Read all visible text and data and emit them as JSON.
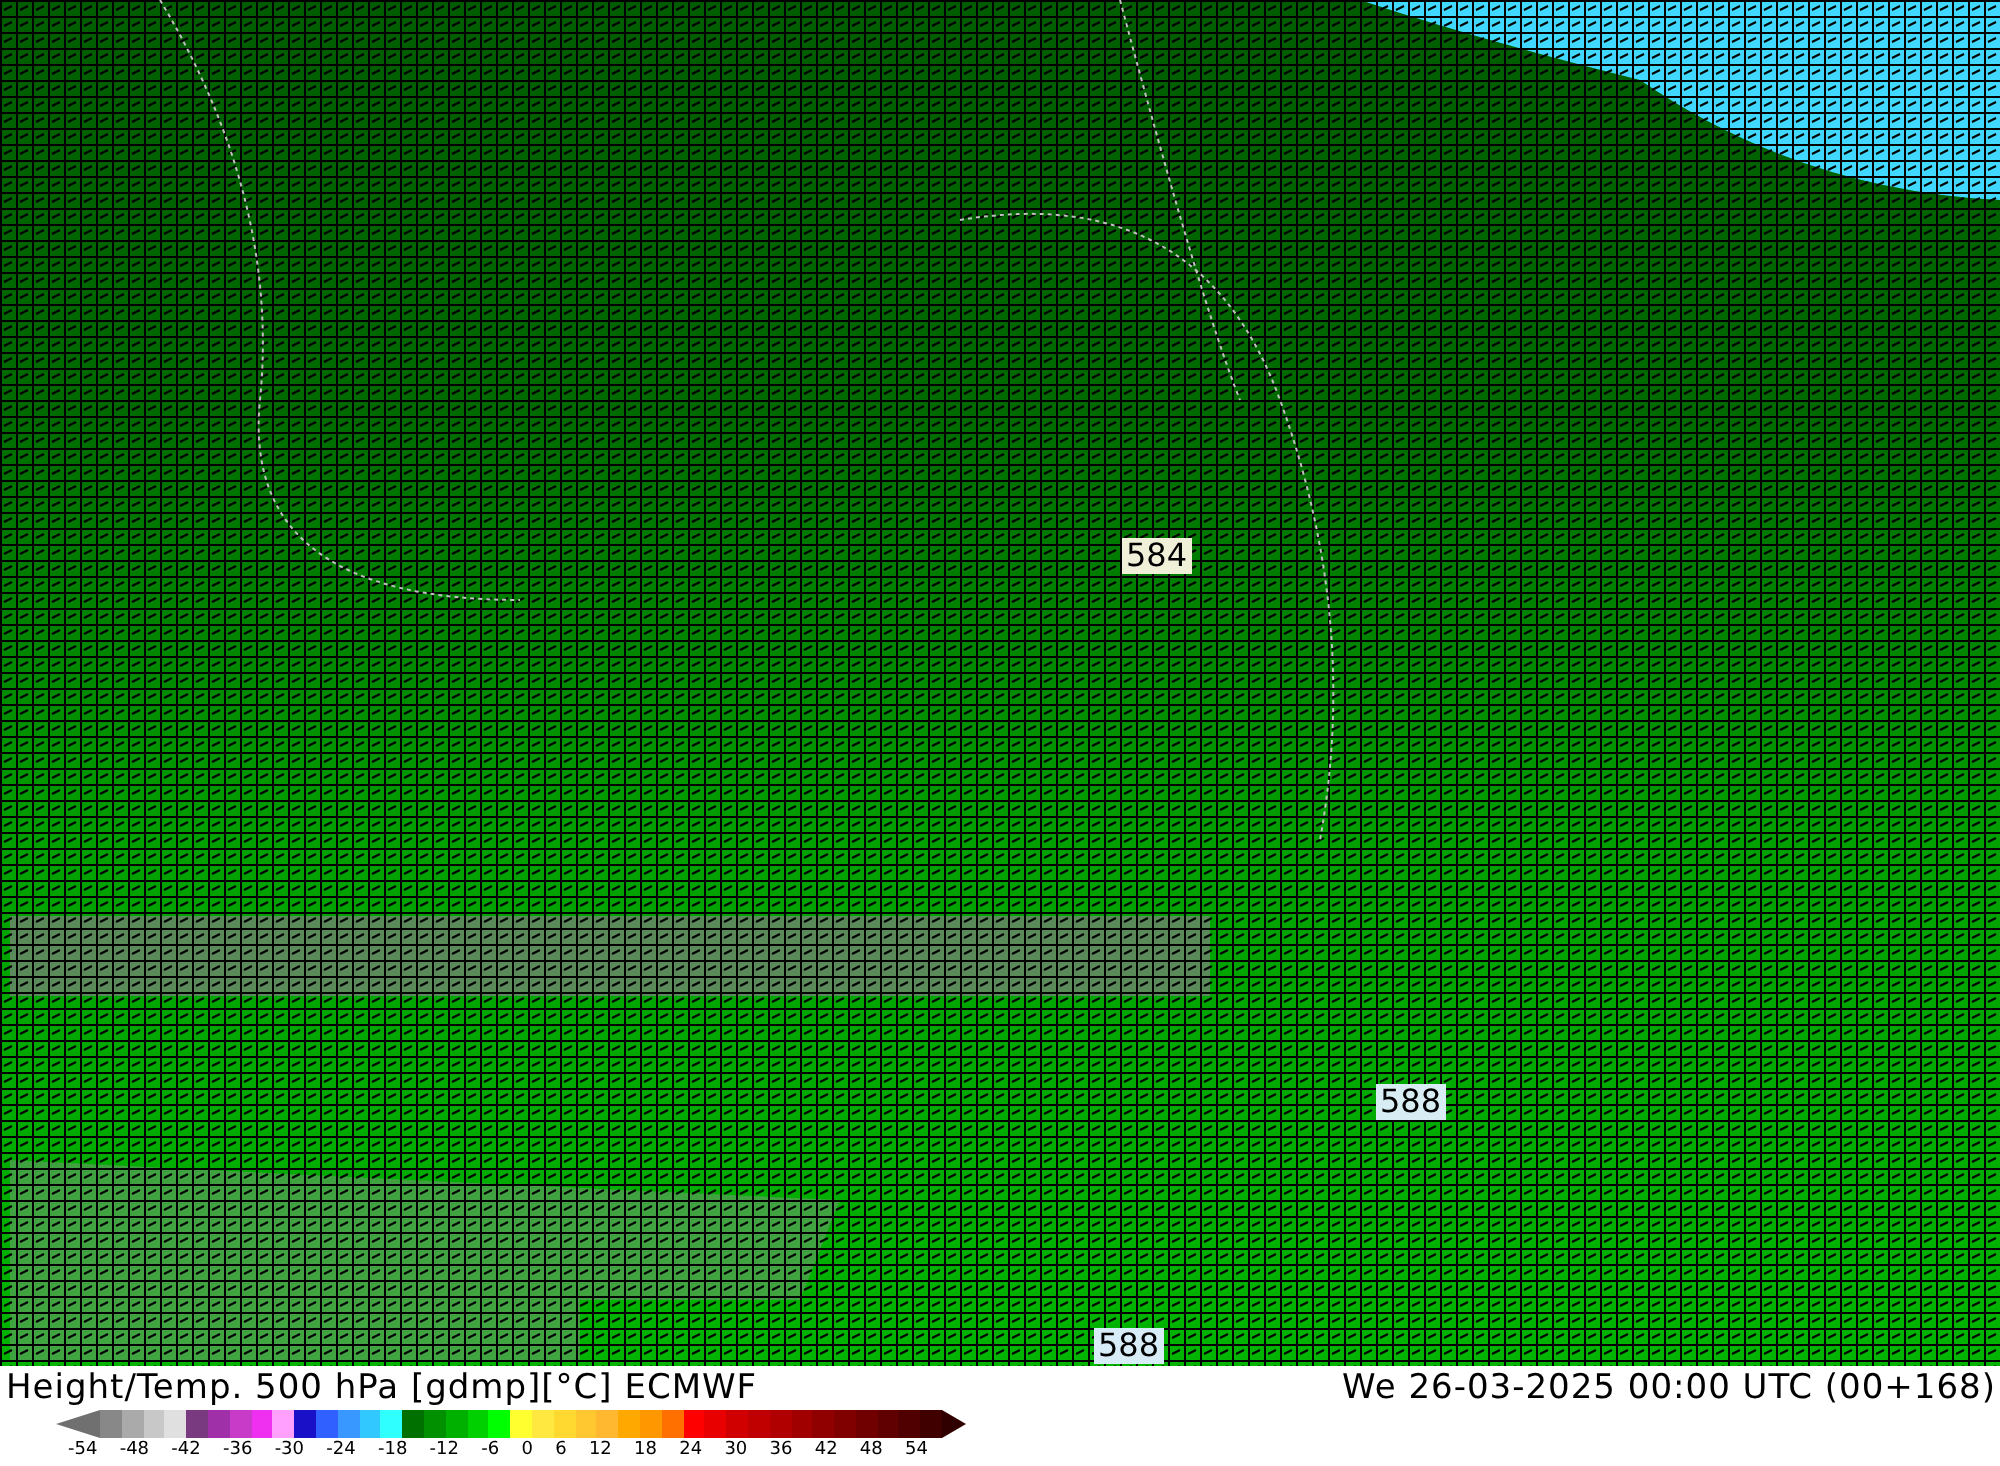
{
  "map": {
    "contour_labels": [
      {
        "text": "584"
      },
      {
        "text": "588"
      },
      {
        "text": "588"
      }
    ]
  },
  "title": "Height/Temp. 500 hPa [gdmp][°C] ECMWF",
  "valid_time": "We 26-03-2025 00:00 UTC (00+168)",
  "legend": {
    "swatches": [
      {
        "color": "#888888"
      },
      {
        "color": "#aaaaaa"
      },
      {
        "color": "#c8c8c8"
      },
      {
        "color": "#e0e0e0"
      },
      {
        "color": "#7a3a80"
      },
      {
        "color": "#a030a8"
      },
      {
        "color": "#c83ac8"
      },
      {
        "color": "#f030f0"
      },
      {
        "color": "#ffa0ff"
      },
      {
        "color": "#1a10c8"
      },
      {
        "color": "#3060ff"
      },
      {
        "color": "#3898ff"
      },
      {
        "color": "#30c8ff"
      },
      {
        "color": "#30ffff"
      },
      {
        "color": "#007000"
      },
      {
        "color": "#009000"
      },
      {
        "color": "#00b000"
      },
      {
        "color": "#00d000"
      },
      {
        "color": "#00ff00"
      },
      {
        "color": "#ffff30"
      },
      {
        "color": "#ffe840"
      },
      {
        "color": "#ffd830"
      },
      {
        "color": "#ffc830"
      },
      {
        "color": "#ffb830"
      },
      {
        "color": "#ffa800"
      },
      {
        "color": "#ff9800"
      },
      {
        "color": "#ff7000"
      },
      {
        "color": "#ff0000"
      },
      {
        "color": "#e80000"
      },
      {
        "color": "#d00000"
      },
      {
        "color": "#c00000"
      },
      {
        "color": "#b00000"
      },
      {
        "color": "#a00000"
      },
      {
        "color": "#900000"
      },
      {
        "color": "#800000"
      },
      {
        "color": "#700000"
      },
      {
        "color": "#600000"
      },
      {
        "color": "#500000"
      },
      {
        "color": "#400000"
      }
    ],
    "ticks": [
      "-54",
      "-48",
      "-42",
      "-36",
      "-30",
      "-24",
      "-18",
      "-12",
      "-6",
      "0",
      "6",
      "12",
      "18",
      "24",
      "30",
      "36",
      "42",
      "48",
      "54"
    ]
  }
}
